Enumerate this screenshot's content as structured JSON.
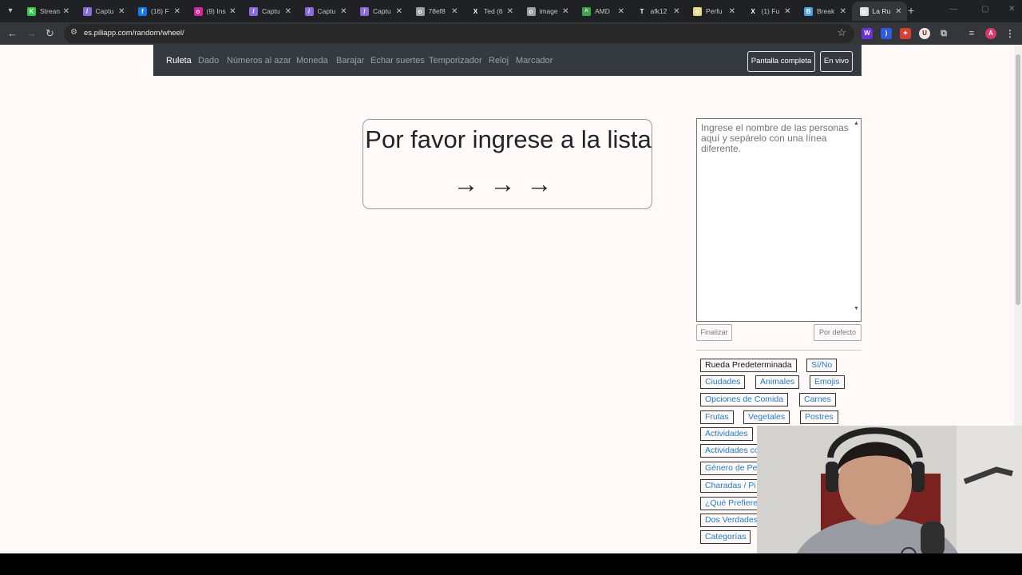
{
  "browser": {
    "tabs": [
      {
        "title": "Strean",
        "color": "#2ecc40",
        "glyph": "K"
      },
      {
        "title": "Captu",
        "color": "#8b6bd9",
        "glyph": "/"
      },
      {
        "title": "(16) F",
        "color": "#1877f2",
        "glyph": "f"
      },
      {
        "title": "(9) Ins",
        "color": "#d6249f",
        "glyph": "o"
      },
      {
        "title": "Captu",
        "color": "#8b6bd9",
        "glyph": "/"
      },
      {
        "title": "Captu",
        "color": "#8b6bd9",
        "glyph": "/"
      },
      {
        "title": "Captu",
        "color": "#8b6bd9",
        "glyph": "/"
      },
      {
        "title": "78ef8",
        "color": "#9aa0a6",
        "glyph": "o"
      },
      {
        "title": "Ted (6",
        "color": "#202124",
        "glyph": "X"
      },
      {
        "title": "image",
        "color": "#9aa0a6",
        "glyph": "o"
      },
      {
        "title": "AMD",
        "color": "#3fa34d",
        "glyph": "^"
      },
      {
        "title": "afk12",
        "color": "#202124",
        "glyph": "T"
      },
      {
        "title": "Perfu",
        "color": "#e8d98a",
        "glyph": "o"
      },
      {
        "title": "(1) Fu",
        "color": "#202124",
        "glyph": "X"
      },
      {
        "title": "Break",
        "color": "#4aa3df",
        "glyph": "B"
      },
      {
        "title": "La Ru",
        "color": "#e0e0e0",
        "glyph": "o"
      }
    ],
    "url": "es.piliapp.com/random/wheel/",
    "profile_initial": "A"
  },
  "navbar": {
    "links": [
      "Ruleta",
      "Dado",
      "Números al azar",
      "Moneda",
      "Barajar",
      "Echar suertes",
      "Temporizador",
      "Reloj",
      "Marcador"
    ],
    "fullscreen_label": "Pantalla completa",
    "live_label": "En vivo"
  },
  "wheel": {
    "message": "Por favor ingrese a la lista",
    "arrows": "→→→"
  },
  "names": {
    "placeholder": "Ingrese el nombre de las personas aquí y sepárelo con una línea diferente.",
    "finish_label": "Finalizar",
    "default_label": "Por defecto"
  },
  "presets": [
    "Rueda Predeterminada",
    "Sí/No",
    "Ciudades",
    "Animales",
    "Emojis",
    "Opciones de Comida",
    "Carnes",
    "Frutas",
    "Vegetales",
    "Postres",
    "Actividades",
    "Actividades co",
    "Género de Pel",
    "Charadas / Pi",
    "¿Qué Prefiere",
    "Dos Verdades",
    "Categorías"
  ]
}
